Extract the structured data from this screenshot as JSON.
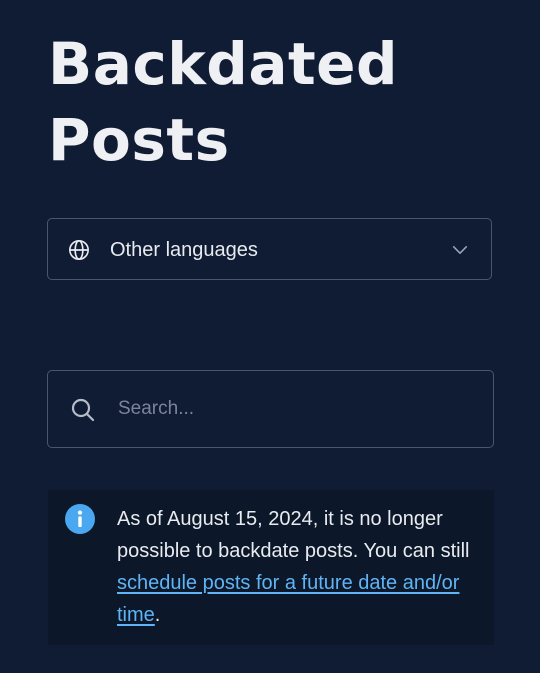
{
  "page": {
    "title": "Backdated Posts"
  },
  "language_selector": {
    "label": "Other languages",
    "icon": "globe-icon",
    "chevron": "chevron-down-icon"
  },
  "search": {
    "placeholder": "Search...",
    "value": "",
    "icon": "search-icon"
  },
  "notice": {
    "icon": "info-icon",
    "text_before": "As of August 15, 2024, it is no longer possible to backdate posts. You can still ",
    "link_text": "schedule posts for a future date and/or time",
    "text_after": "."
  },
  "colors": {
    "background": "#0f1c33",
    "notice_background": "#0c1729",
    "border": "#4a5670",
    "link": "#5fb4f5",
    "info_icon": "#4aa8f0",
    "text": "#e8ebf0"
  }
}
